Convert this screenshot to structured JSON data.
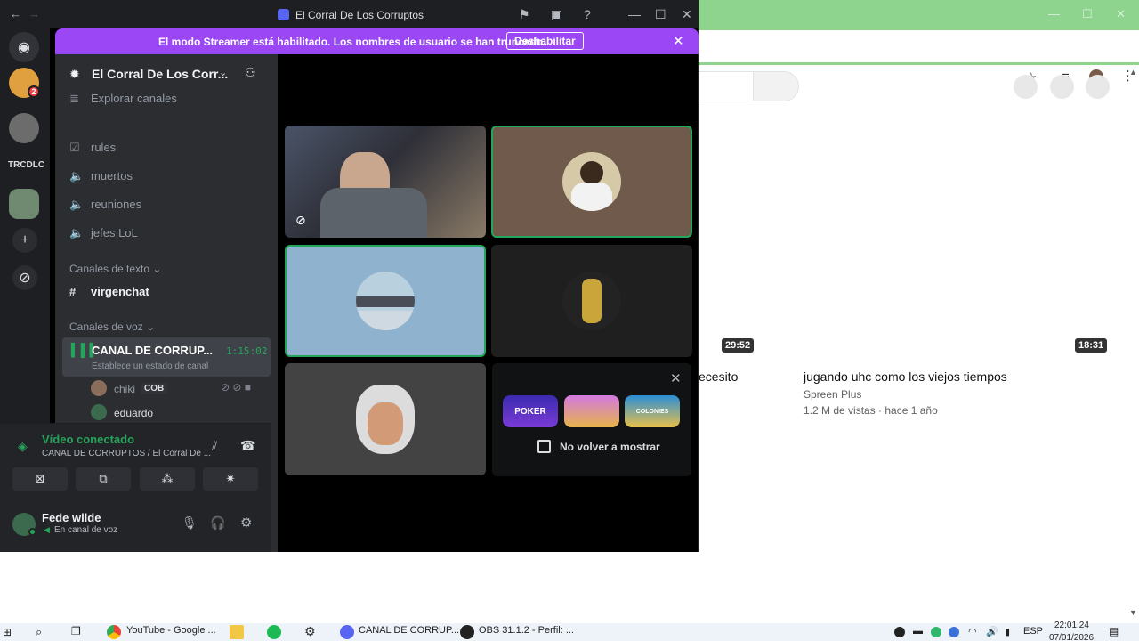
{
  "colors": {
    "discord_bg": "#2b2d31",
    "streamer_purple": "#9b47f5",
    "voice_green": "#23a55a",
    "chrome_green": "#8ed48e"
  },
  "discord": {
    "window_title": "El Corral De Los Corruptos",
    "streamer_mode": {
      "text": "El modo Streamer está habilitado. Los nombres de usuario se han truncado.",
      "button": "Deshabilitar"
    },
    "server_text": "TRCDLC",
    "server_badge": "2",
    "guild_name": "El Corral De Los Corr...",
    "channels": {
      "explore": "Explorar canales",
      "items": [
        "rules",
        "muertos",
        "reuniones",
        "jefes LoL"
      ],
      "text_category": "Canales de texto",
      "text_channel": "virgenchat",
      "voice_category": "Canales de voz",
      "voice_channel": "CANAL DE CORRUP...",
      "voice_time": "1:15:02",
      "voice_status": "Establece un estado de canal",
      "voice_users": [
        {
          "name": "chiki",
          "tag": "COB"
        },
        {
          "name": "eduardo"
        }
      ]
    },
    "voice_panel": {
      "status": "Vídeo conectado",
      "subtitle": "CANAL DE CORRUPTOS / El Corral De ...",
      "username": "Fede wilde",
      "user_status": "En canal de voz"
    },
    "activity": {
      "games": [
        "POKER",
        "",
        "COLONIES"
      ],
      "dont_show": "No volver a mostrar"
    }
  },
  "youtube": {
    "durations": [
      "29:52",
      "18:31"
    ],
    "partial_title": "ecesito",
    "video_title": "jugando uhc como los viejos tiempos",
    "channel": "Spreen Plus",
    "meta": "1.2 M de vistas · hace 1 año"
  },
  "taskbar": {
    "apps": [
      {
        "label": "YouTube - Google ..."
      },
      {
        "label": "CANAL DE CORRUP..."
      },
      {
        "label": "OBS 31.1.2 - Perfil: ..."
      }
    ],
    "lang": "ESP",
    "time": "22:01:24",
    "date": "07/01/2026"
  }
}
